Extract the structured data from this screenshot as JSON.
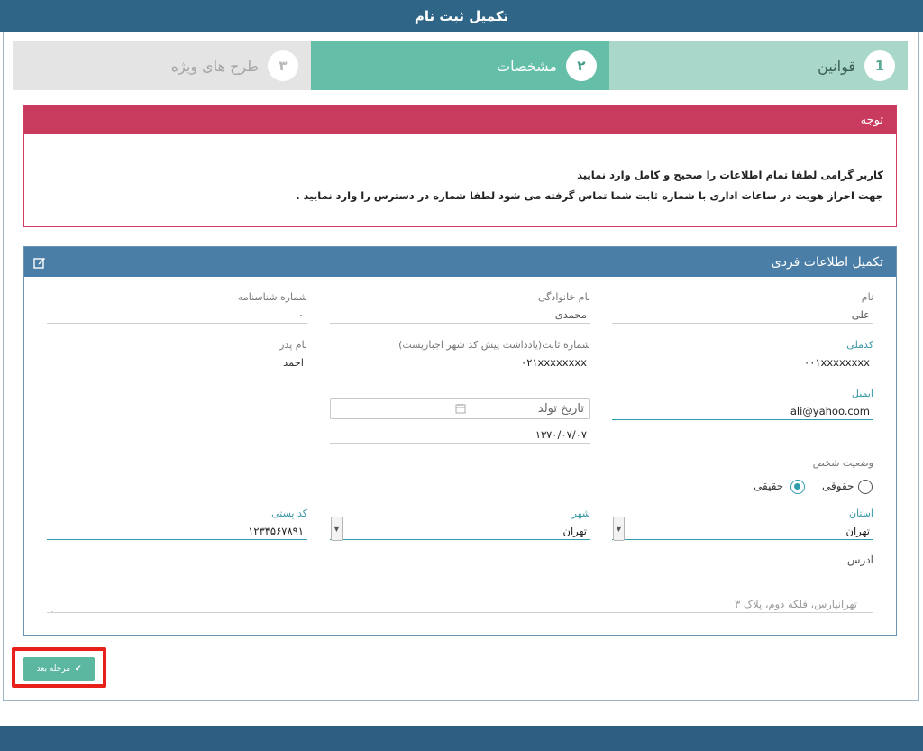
{
  "header": {
    "title": "تکمیل ثبت نام"
  },
  "steps": [
    {
      "number": "1",
      "label": "قوانین"
    },
    {
      "number": "۲",
      "label": "مشخصات"
    },
    {
      "number": "۳",
      "label": "طرح های ویژه"
    }
  ],
  "notice": {
    "title": "توجه",
    "line1": "کاربر گرامی لطفا تمام اطلاعات را صحیح و کامل وارد نمایید",
    "line2": "جهت احراز هویت در ساعات اداری با شماره ثابت شما تماس گرفته می شود لطفا شماره در دسترس را وارد نمایید ."
  },
  "form": {
    "title": "تکمیل اطلاعات فردی",
    "first_name": {
      "label": "نام",
      "value": "علی"
    },
    "last_name": {
      "label": "نام خانوادگی",
      "value": "محمدی"
    },
    "id_number": {
      "label": "شماره شناسنامه",
      "value": "۰"
    },
    "national_code": {
      "label": "کدملی",
      "value": "۰۰۱xxxxxxxx"
    },
    "phone": {
      "label": "شماره ثابت(یادداشت پیش کد شهر اجباریست)",
      "value": "۰۲۱xxxxxxxx"
    },
    "father_name": {
      "label": "نام پدر",
      "value": "احمد"
    },
    "email": {
      "label": "ایمیل",
      "value": "ali@yahoo.com"
    },
    "birth_date": {
      "placeholder": "تاریخ تولد",
      "value": "۱۳۷۰/۰۷/۰۷"
    },
    "person_status": {
      "label": "وضعیت شخص",
      "option_natural": "حقیقی",
      "option_legal": "حقوقی",
      "selected": "حقیقی"
    },
    "province": {
      "label": "استان",
      "value": "تهران"
    },
    "city": {
      "label": "شهر",
      "value": "تهران"
    },
    "postal_code": {
      "label": "کد پستی",
      "value": "۱۲۳۴۵۶۷۸۹۱"
    },
    "address": {
      "label": "آدرس",
      "value": "تهرانپارس، فلکه دوم، پلاک ۳"
    }
  },
  "next_button": {
    "label": "مرحله بعد"
  },
  "colors": {
    "primary": "#2f6587",
    "accent": "#5cb7a0",
    "alert": "#c93b5e",
    "highlight": "#e8201a"
  }
}
